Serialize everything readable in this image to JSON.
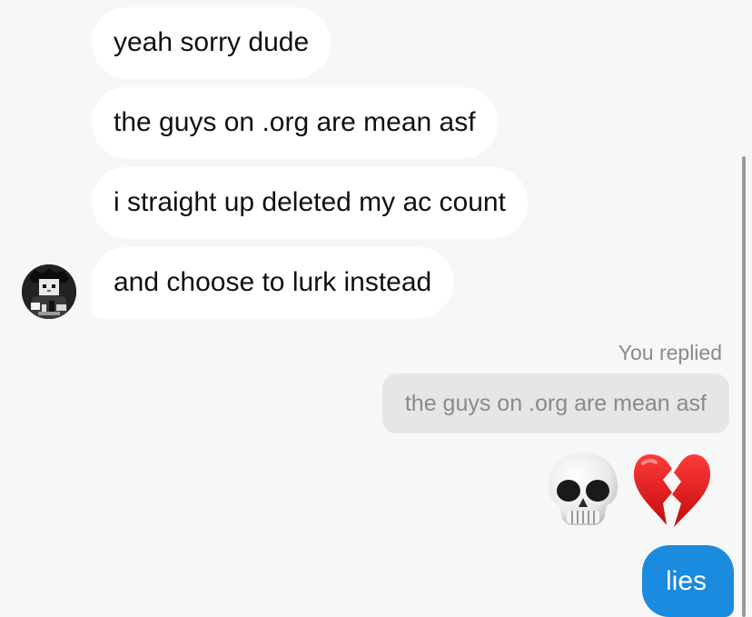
{
  "conversation": {
    "incoming": [
      {
        "text": "yeah sorry dude"
      },
      {
        "text": "the guys on .org are mean asf"
      },
      {
        "text": "i straight up deleted my ac count"
      },
      {
        "text": "and choose to lurk instead"
      }
    ],
    "reply": {
      "label": "You replied",
      "quoted_text": "the guys on .org are mean asf"
    },
    "emojis": [
      "skull-emoji",
      "broken-heart-emoji"
    ],
    "outgoing": {
      "text": "lies"
    }
  },
  "colors": {
    "background": "#f7f7f7",
    "incoming_bubble": "#ffffff",
    "outgoing_bubble": "#1a8bde",
    "quoted_bubble": "#e6e6e6",
    "muted_text": "#8a8a8a"
  }
}
